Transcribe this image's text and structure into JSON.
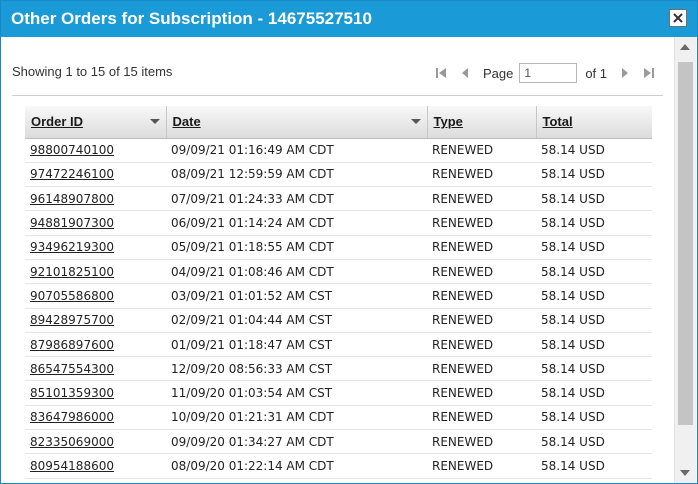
{
  "dialog": {
    "title": "Other Orders for Subscription - 14675527510",
    "close_icon": "close-icon"
  },
  "summary": {
    "showing_text": "Showing 1 to 15 of 15 items"
  },
  "pager": {
    "page_label": "Page",
    "page_value": "1",
    "of_label": "of 1",
    "icons": [
      "first-page-icon",
      "prev-page-icon",
      "next-page-icon",
      "last-page-icon"
    ]
  },
  "table": {
    "columns": [
      {
        "label": "Order ID",
        "sortable_menu": true
      },
      {
        "label": "Date",
        "sortable_menu": true
      },
      {
        "label": "Type",
        "sortable_menu": false
      },
      {
        "label": "Total",
        "sortable_menu": false
      }
    ],
    "rows": [
      {
        "order_id": "98800740100",
        "date": "09/09/21 01:16:49 AM CDT",
        "type": "RENEWED",
        "total": "58.14 USD"
      },
      {
        "order_id": "97472246100",
        "date": "08/09/21 12:59:59 AM CDT",
        "type": "RENEWED",
        "total": "58.14 USD"
      },
      {
        "order_id": "96148907800",
        "date": "07/09/21 01:24:33 AM CDT",
        "type": "RENEWED",
        "total": "58.14 USD"
      },
      {
        "order_id": "94881907300",
        "date": "06/09/21 01:14:24 AM CDT",
        "type": "RENEWED",
        "total": "58.14 USD"
      },
      {
        "order_id": "93496219300",
        "date": "05/09/21 01:18:55 AM CDT",
        "type": "RENEWED",
        "total": "58.14 USD"
      },
      {
        "order_id": "92101825100",
        "date": "04/09/21 01:08:46 AM CDT",
        "type": "RENEWED",
        "total": "58.14 USD"
      },
      {
        "order_id": "90705586800",
        "date": "03/09/21 01:01:52 AM CST",
        "type": "RENEWED",
        "total": "58.14 USD"
      },
      {
        "order_id": "89428975700",
        "date": "02/09/21 01:04:44 AM CST",
        "type": "RENEWED",
        "total": "58.14 USD"
      },
      {
        "order_id": "87986897600",
        "date": "01/09/21 01:18:47 AM CST",
        "type": "RENEWED",
        "total": "58.14 USD"
      },
      {
        "order_id": "86547554300",
        "date": "12/09/20 08:56:33 AM CST",
        "type": "RENEWED",
        "total": "58.14 USD"
      },
      {
        "order_id": "85101359300",
        "date": "11/09/20 01:03:54 AM CST",
        "type": "RENEWED",
        "total": "58.14 USD"
      },
      {
        "order_id": "83647986000",
        "date": "10/09/20 01:21:31 AM CDT",
        "type": "RENEWED",
        "total": "58.14 USD"
      },
      {
        "order_id": "82335069000",
        "date": "09/09/20 01:34:27 AM CDT",
        "type": "RENEWED",
        "total": "58.14 USD"
      },
      {
        "order_id": "80954188600",
        "date": "08/09/20 01:22:14 AM CDT",
        "type": "RENEWED",
        "total": "58.14 USD"
      }
    ]
  },
  "colors": {
    "titlebar": "#1a9ad6",
    "title_text": "#ffffff",
    "header_bg": "#dcdcdc",
    "scroll_thumb": "#c4c4c4"
  }
}
